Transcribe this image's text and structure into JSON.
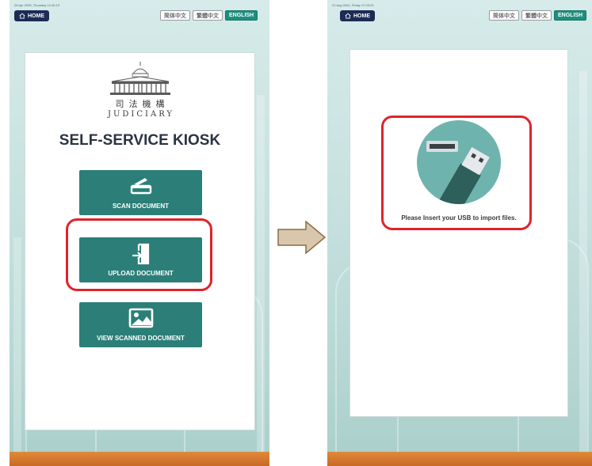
{
  "left_screen": {
    "timestamp": "28 Apr 2025, Thursday 12:40:13",
    "home_label": "HOME",
    "languages": [
      "简体中文",
      "繁體中文",
      "ENGLISH"
    ],
    "active_language": "ENGLISH",
    "logo": {
      "chinese": "司法機構",
      "english": "JUDICIARY"
    },
    "title": "SELF-SERVICE KIOSK",
    "buttons": {
      "scan": "SCAN DOCUMENT",
      "upload": "UPLOAD DOCUMENT",
      "view": "VIEW SCANNED DOCUMENT"
    },
    "highlighted": "UPLOAD DOCUMENT"
  },
  "right_screen": {
    "timestamp": "21 Aug 2024, Friday 17:03:23",
    "home_label": "HOME",
    "languages": [
      "简体中文",
      "繁體中文",
      "ENGLISH"
    ],
    "active_language": "ENGLISH",
    "usb_message": "Please Insert your USB to import files."
  },
  "colors": {
    "tile": "#2b7f78",
    "home_button": "#1d2b55",
    "highlight": "#e0232a",
    "active_language": "#1d8f7f",
    "bottom_bar": "#c86a24"
  },
  "icons": [
    "home-icon",
    "scanner-icon",
    "upload-document-icon",
    "image-icon",
    "usb-drive-icon",
    "arrow-right-icon"
  ]
}
